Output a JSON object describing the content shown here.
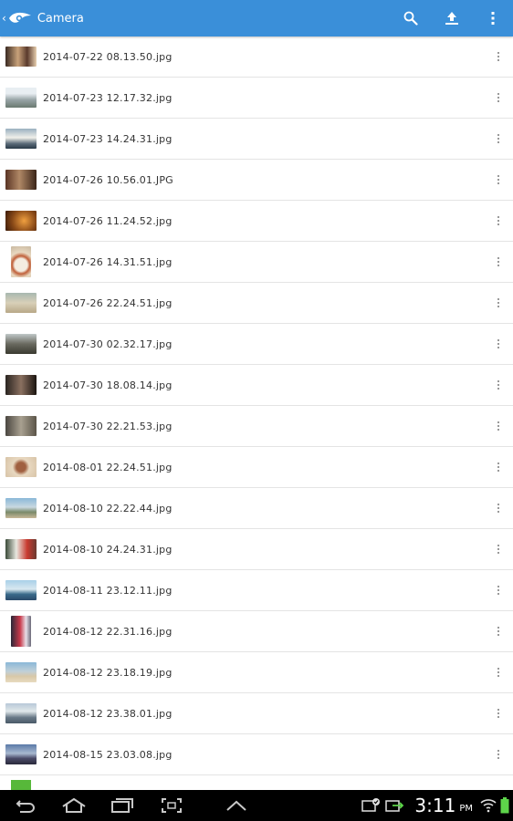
{
  "app": {
    "title": "Camera"
  },
  "colors": {
    "appbar": "#3a8fd9",
    "navbar": "#000000",
    "battery": "#5dd44a"
  },
  "icons": {
    "back": "chevron-left-icon",
    "logo": "app-logo-icon",
    "search": "search-icon",
    "upload": "upload-icon",
    "overflow": "overflow-menu-icon",
    "item_more": "more-vertical-icon"
  },
  "files": [
    {
      "name": "2014-07-22 08.13.50.jpg"
    },
    {
      "name": "2014-07-23 12.17.32.jpg"
    },
    {
      "name": "2014-07-23 14.24.31.jpg"
    },
    {
      "name": "2014-07-26 10.56.01.JPG"
    },
    {
      "name": "2014-07-26 11.24.52.jpg"
    },
    {
      "name": "2014-07-26 14.31.51.jpg"
    },
    {
      "name": "2014-07-26 22.24.51.jpg"
    },
    {
      "name": "2014-07-30 02.32.17.jpg"
    },
    {
      "name": "2014-07-30 18.08.14.jpg"
    },
    {
      "name": "2014-07-30 22.21.53.jpg"
    },
    {
      "name": "2014-08-01 22.24.51.jpg"
    },
    {
      "name": "2014-08-10 22.22.44.jpg"
    },
    {
      "name": "2014-08-10 24.24.31.jpg"
    },
    {
      "name": "2014-08-11 23.12.11.jpg"
    },
    {
      "name": "2014-08-12 22.31.16.jpg"
    },
    {
      "name": "2014-08-12 23.18.19.jpg"
    },
    {
      "name": "2014-08-12 23.38.01.jpg"
    },
    {
      "name": "2014-08-15 23.03.08.jpg"
    }
  ],
  "status": {
    "time": "3:11",
    "ampm": "PM"
  }
}
